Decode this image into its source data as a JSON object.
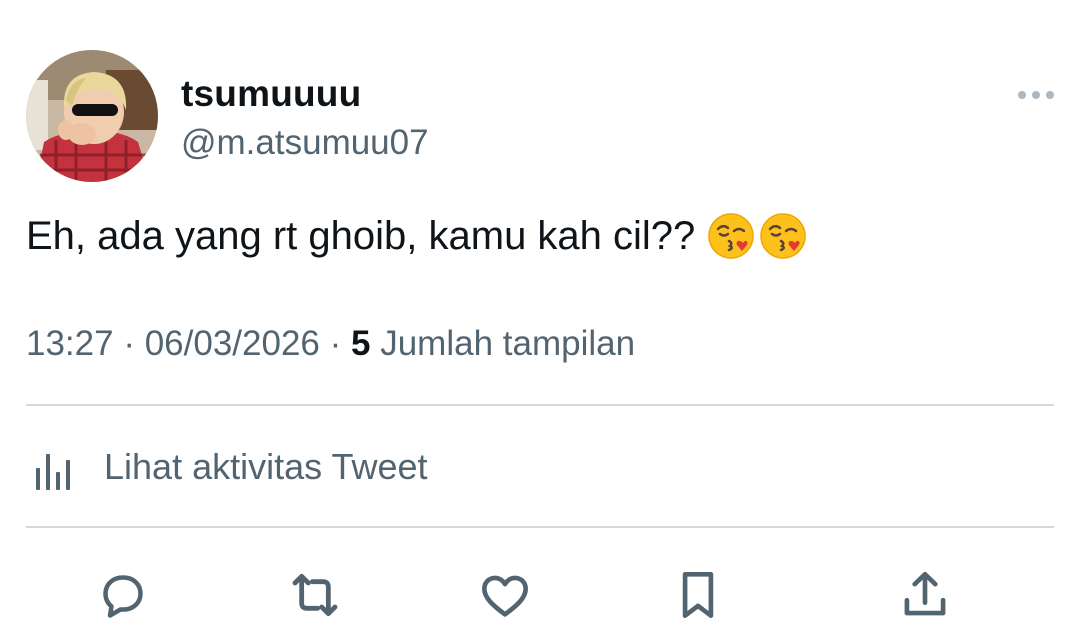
{
  "user": {
    "display_name": "tsumuuuu",
    "handle": "@m.atsumuu07",
    "avatar_icon": "avatar-photo"
  },
  "tweet": {
    "text": "Eh, ada yang rt ghoib, kamu kah cil??",
    "emojis": [
      "face-blowing-a-kiss",
      "face-blowing-a-kiss"
    ]
  },
  "meta": {
    "time": "13:27",
    "separator": "·",
    "date": "06/03/2026",
    "views_count": "5",
    "views_label": "Jumlah tampilan"
  },
  "activity": {
    "label": "Lihat aktivitas Tweet",
    "icon": "analytics-icon"
  },
  "actions": {
    "icons": [
      "reply-icon",
      "retweet-icon",
      "like-icon",
      "bookmark-icon",
      "share-icon"
    ]
  },
  "colors": {
    "text_primary": "#0f1419",
    "text_secondary": "#536471",
    "divider": "#cfd9de",
    "background": "#ffffff"
  }
}
